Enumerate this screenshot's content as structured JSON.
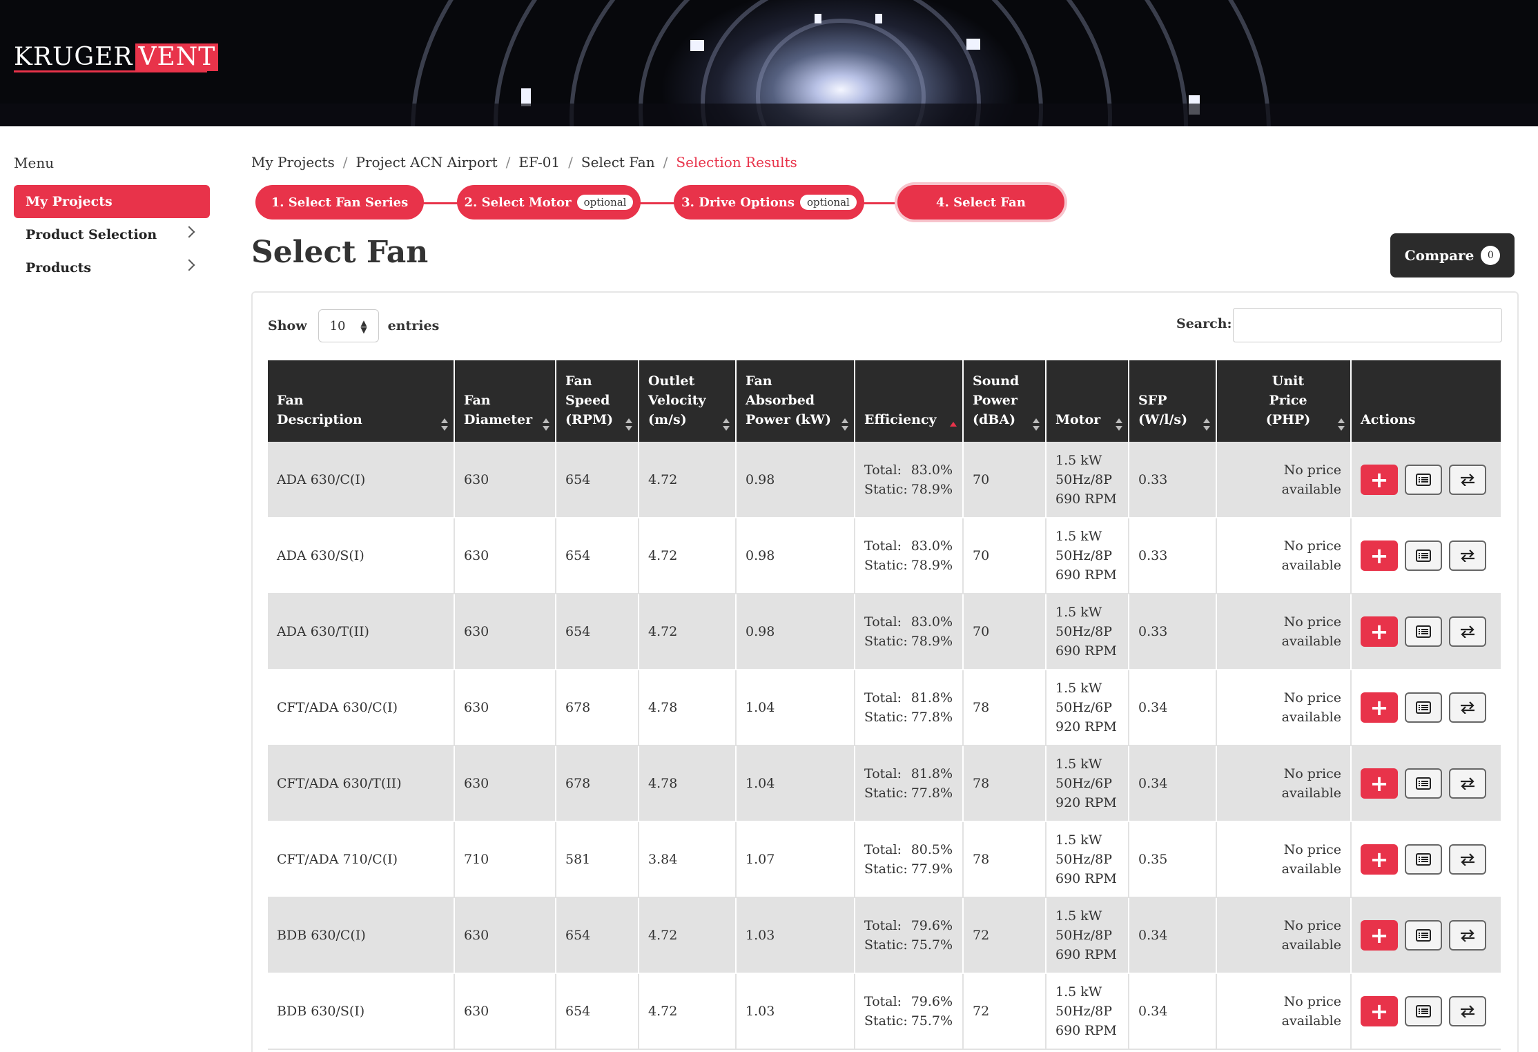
{
  "brand": {
    "name_part1": "KRUGER",
    "name_part2": "VENT"
  },
  "sidebar": {
    "title": "Menu",
    "items": [
      {
        "label": "My Projects",
        "active": true,
        "has_chevron": false
      },
      {
        "label": "Product Selection",
        "active": false,
        "has_chevron": true
      },
      {
        "label": "Products",
        "active": false,
        "has_chevron": true
      }
    ]
  },
  "breadcrumb": [
    "My Projects",
    "Project ACN Airport",
    "EF-01",
    "Select Fan",
    "Selection Results"
  ],
  "steps": [
    {
      "label": "1. Select Fan Series",
      "badge": ""
    },
    {
      "label": "2. Select Motor",
      "badge": "optional"
    },
    {
      "label": "3. Drive Options",
      "badge": "optional"
    },
    {
      "label": "4. Select Fan",
      "badge": ""
    }
  ],
  "page_title": "Select Fan",
  "compare": {
    "label": "Compare",
    "count": "0"
  },
  "table_controls": {
    "show_label": "Show",
    "entries_value": "10",
    "entries_label": "entries",
    "search_label": "Search:",
    "search_value": ""
  },
  "table": {
    "headers": [
      "Fan Description",
      "Fan Diameter",
      "Fan Speed (RPM)",
      "Outlet Velocity (m/s)",
      "Fan Absorbed Power (kW)",
      "Efficiency",
      "Sound Power (dBA)",
      "Motor",
      "SFP (W/l/s)",
      "Unit Price (PHP)",
      "Actions"
    ],
    "rows": [
      {
        "desc": "ADA 630/C(I)",
        "diameter": "630",
        "speed": "654",
        "velocity": "4.72",
        "power": "0.98",
        "eff_total": "83.0%",
        "eff_static": "78.9%",
        "sound": "70",
        "motor_kw": "1.5 kW",
        "motor_hz": "50Hz/8P",
        "motor_rpm": "690 RPM",
        "sfp": "0.33",
        "price": "No price available"
      },
      {
        "desc": "ADA 630/S(I)",
        "diameter": "630",
        "speed": "654",
        "velocity": "4.72",
        "power": "0.98",
        "eff_total": "83.0%",
        "eff_static": "78.9%",
        "sound": "70",
        "motor_kw": "1.5 kW",
        "motor_hz": "50Hz/8P",
        "motor_rpm": "690 RPM",
        "sfp": "0.33",
        "price": "No price available"
      },
      {
        "desc": "ADA 630/T(II)",
        "diameter": "630",
        "speed": "654",
        "velocity": "4.72",
        "power": "0.98",
        "eff_total": "83.0%",
        "eff_static": "78.9%",
        "sound": "70",
        "motor_kw": "1.5 kW",
        "motor_hz": "50Hz/8P",
        "motor_rpm": "690 RPM",
        "sfp": "0.33",
        "price": "No price available"
      },
      {
        "desc": "CFT/ADA 630/C(I)",
        "diameter": "630",
        "speed": "678",
        "velocity": "4.78",
        "power": "1.04",
        "eff_total": "81.8%",
        "eff_static": "77.8%",
        "sound": "78",
        "motor_kw": "1.5 kW",
        "motor_hz": "50Hz/6P",
        "motor_rpm": "920 RPM",
        "sfp": "0.34",
        "price": "No price available"
      },
      {
        "desc": "CFT/ADA 630/T(II)",
        "diameter": "630",
        "speed": "678",
        "velocity": "4.78",
        "power": "1.04",
        "eff_total": "81.8%",
        "eff_static": "77.8%",
        "sound": "78",
        "motor_kw": "1.5 kW",
        "motor_hz": "50Hz/6P",
        "motor_rpm": "920 RPM",
        "sfp": "0.34",
        "price": "No price available"
      },
      {
        "desc": "CFT/ADA 710/C(I)",
        "diameter": "710",
        "speed": "581",
        "velocity": "3.84",
        "power": "1.07",
        "eff_total": "80.5%",
        "eff_static": "77.9%",
        "sound": "78",
        "motor_kw": "1.5 kW",
        "motor_hz": "50Hz/8P",
        "motor_rpm": "690 RPM",
        "sfp": "0.35",
        "price": "No price available"
      },
      {
        "desc": "BDB 630/C(I)",
        "diameter": "630",
        "speed": "654",
        "velocity": "4.72",
        "power": "1.03",
        "eff_total": "79.6%",
        "eff_static": "75.7%",
        "sound": "72",
        "motor_kw": "1.5 kW",
        "motor_hz": "50Hz/8P",
        "motor_rpm": "690 RPM",
        "sfp": "0.34",
        "price": "No price available"
      },
      {
        "desc": "BDB 630/S(I)",
        "diameter": "630",
        "speed": "654",
        "velocity": "4.72",
        "power": "1.03",
        "eff_total": "79.6%",
        "eff_static": "75.7%",
        "sound": "72",
        "motor_kw": "1.5 kW",
        "motor_hz": "50Hz/8P",
        "motor_rpm": "690 RPM",
        "sfp": "0.34",
        "price": "No price available"
      }
    ],
    "eff_total_label": "Total:",
    "eff_static_label": "Static:",
    "sorted_column": "Efficiency"
  },
  "colors": {
    "accent": "#e8334a",
    "header_dark": "#2b2b2b",
    "row_alt": "#e2e2e2"
  }
}
